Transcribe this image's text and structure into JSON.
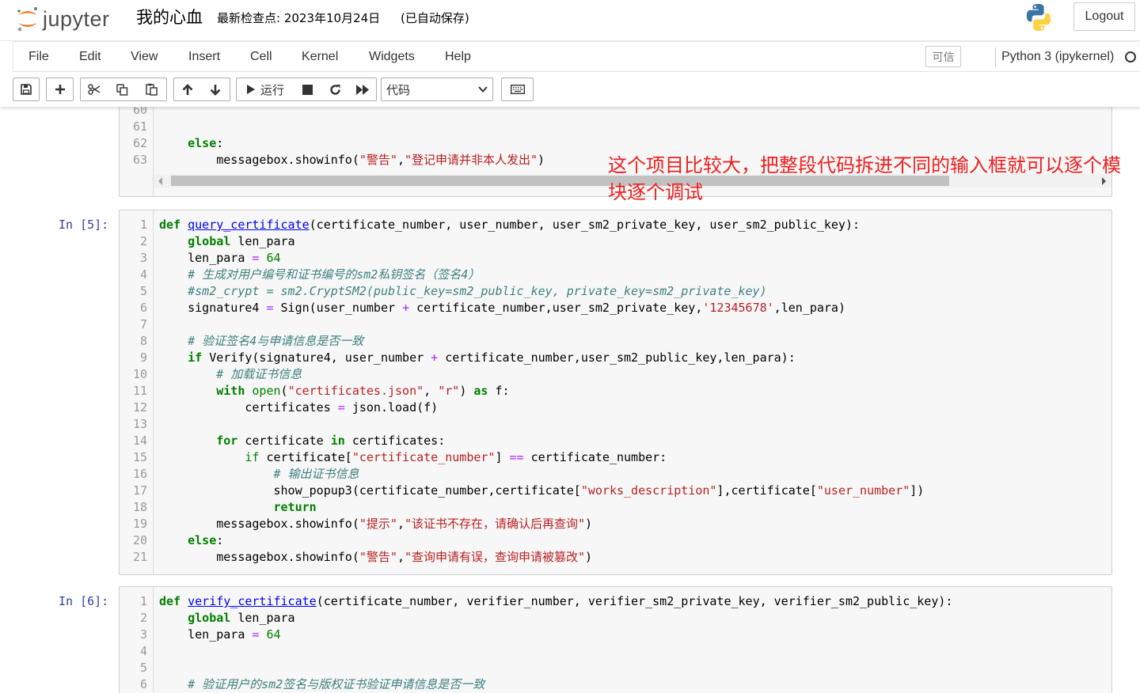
{
  "header": {
    "logo_text": "jupyter",
    "notebook_title": "我的心血",
    "checkpoint": "最新检查点: 2023年10月24日",
    "autosave": "(已自动保存)",
    "logout_label": "Logout"
  },
  "menubar": {
    "items": [
      "File",
      "Edit",
      "View",
      "Insert",
      "Cell",
      "Kernel",
      "Widgets",
      "Help"
    ],
    "trusted_label": "可信",
    "kernel_name": "Python 3 (ipykernel)"
  },
  "toolbar": {
    "run_label": "运行",
    "cell_type": "代码"
  },
  "annotation": "这个项目比较大，把整段代码拆进不同的输入框就可以逐个模块逐个调试",
  "cells": {
    "partial": {
      "line_numbers": [
        "60",
        "61",
        "62",
        "63"
      ],
      "lines": [
        "",
        "",
        "    else:",
        "        messagebox.showinfo(\"警告\",\"登记申请并非本人发出\")"
      ]
    },
    "cell5": {
      "prompt": "In  [5]:",
      "line_numbers": [
        "1",
        "2",
        "3",
        "4",
        "5",
        "6",
        "7",
        "8",
        "9",
        "10",
        "11",
        "12",
        "13",
        "14",
        "15",
        "16",
        "17",
        "18",
        "19",
        "20",
        "21"
      ],
      "lines": [
        "def query_certificate(certificate_number, user_number, user_sm2_private_key, user_sm2_public_key):",
        "    global len_para",
        "    len_para = 64",
        "    # 生成对用户编号和证书编号的sm2私钥签名（签名4）",
        "    #sm2_crypt = sm2.CryptSM2(public_key=sm2_public_key, private_key=sm2_private_key)",
        "    signature4 = Sign(user_number + certificate_number,user_sm2_private_key,'12345678',len_para)",
        "",
        "    # 验证签名4与申请信息是否一致",
        "    if Verify(signature4, user_number + certificate_number,user_sm2_public_key,len_para):",
        "        # 加载证书信息",
        "        with open(\"certificates.json\", \"r\") as f:",
        "            certificates = json.load(f)",
        "",
        "        for certificate in certificates:",
        "            if certificate[\"certificate_number\"] == certificate_number:",
        "                # 输出证书信息",
        "                show_popup3(certificate_number,certificate[\"works_description\"],certificate[\"user_number\"])",
        "                return",
        "        messagebox.showinfo(\"提示\",\"该证书不存在，请确认后再查询\")",
        "    else:",
        "        messagebox.showinfo(\"警告\",\"查询申请有误，查询申请被篡改\")"
      ]
    },
    "cell6": {
      "prompt": "In  [6]:",
      "line_numbers": [
        "1",
        "2",
        "3",
        "4",
        "5",
        "6"
      ],
      "lines": [
        "def verify_certificate(certificate_number, verifier_number, verifier_sm2_private_key, verifier_sm2_public_key):",
        "    global len_para",
        "    len_para = 64",
        "",
        "",
        "    # 验证用户的sm2签名与版权证书验证申请信息是否一致"
      ]
    }
  },
  "colors": {
    "keyword": "#008000",
    "string": "#ba2121",
    "comment": "#408080",
    "operator": "#aa22ff",
    "function_def": "#0000ff",
    "prompt": "#303f9f",
    "annotation": "#f01e1e"
  }
}
